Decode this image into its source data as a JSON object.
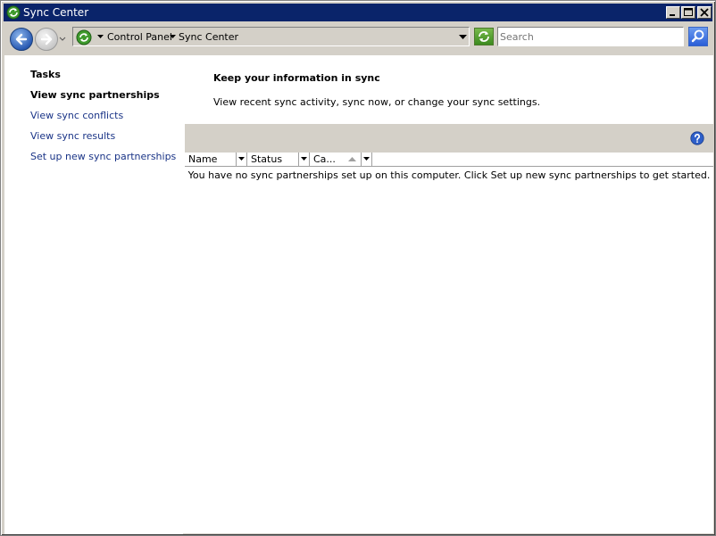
{
  "window": {
    "title": "Sync Center"
  },
  "address": {
    "crumbs": [
      "Control Panel",
      "Sync Center"
    ]
  },
  "search": {
    "placeholder": "Search"
  },
  "sidebar": {
    "heading": "Tasks",
    "current": "View sync partnerships",
    "links": [
      "View sync conflicts",
      "View sync results",
      "Set up new sync partnerships"
    ]
  },
  "main": {
    "title": "Keep your information in sync",
    "description": "View recent sync activity, sync now, or change your sync settings.",
    "columns": [
      "Name",
      "Status",
      "Ca..."
    ],
    "empty_message": "You have no sync partnerships set up on this computer. Click Set up new sync partnerships to get started."
  },
  "colors": {
    "title_bar": "#0a246a",
    "chrome": "#d4d0c8",
    "link": "#1a3487"
  },
  "icons": {
    "title": "sync-center-icon",
    "back": "back-arrow-icon",
    "forward": "forward-arrow-icon",
    "address": "sync-center-icon",
    "refresh": "refresh-icon",
    "search": "search-icon",
    "help": "help-icon"
  }
}
